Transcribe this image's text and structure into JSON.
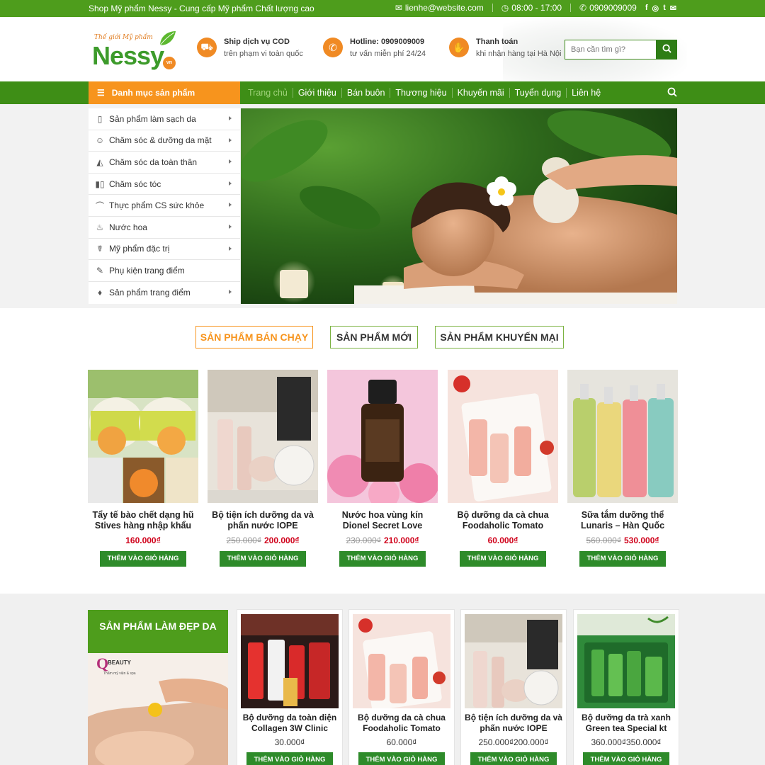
{
  "topbar": {
    "tagline": "Shop Mỹ phẩm Nessy - Cung cấp Mỹ phẩm Chất lượng cao",
    "email": "lienhe@website.com",
    "hours": "08:00 - 17:00",
    "phone": "0909009009"
  },
  "logo": {
    "tagline": "Thế giới Mỹ phẩm",
    "name": "Nessy",
    "badge": "vn"
  },
  "header_info": [
    {
      "title": "Ship dịch vụ COD",
      "sub": "trên phạm vi toàn quốc",
      "icon": "truck-icon"
    },
    {
      "title": "Hotline: 0909009009",
      "sub": "tư vấn miễn phí 24/24",
      "icon": "phone-icon"
    },
    {
      "title": "Thanh toán",
      "sub": "khi nhận hàng tại Hà Nội",
      "icon": "handshake-icon"
    }
  ],
  "search": {
    "placeholder": "Bạn cần tìm gì?"
  },
  "nav": {
    "category_label": "Danh mục sản phẩm",
    "items": [
      "Trang chủ",
      "Giới thiệu",
      "Bán buôn",
      "Thương hiệu",
      "Khuyến mãi",
      "Tuyển dụng",
      "Liên hệ"
    ]
  },
  "sidebar": [
    {
      "label": "Sản phẩm làm sạch da",
      "icon": "tube-icon",
      "has_sub": true
    },
    {
      "label": "Chăm sóc & dưỡng da mặt",
      "icon": "face-care-icon",
      "has_sub": true
    },
    {
      "label": "Chăm sóc da toàn thân",
      "icon": "body-care-icon",
      "has_sub": true
    },
    {
      "label": "Chăm sóc tóc",
      "icon": "hair-care-icon",
      "has_sub": true
    },
    {
      "label": "Thực phẩm CS sức khỏe",
      "icon": "supplement-icon",
      "has_sub": true
    },
    {
      "label": "Nước hoa",
      "icon": "perfume-icon",
      "has_sub": true
    },
    {
      "label": "Mỹ phẩm đặc trị",
      "icon": "treatment-icon",
      "has_sub": true
    },
    {
      "label": "Phụ kiện trang điểm",
      "icon": "accessory-icon",
      "has_sub": false
    },
    {
      "label": "Sản phẩm trang điểm",
      "icon": "makeup-icon",
      "has_sub": true
    }
  ],
  "tabs": [
    "SẢN PHẨM BÁN CHẠY",
    "SẢN PHẨM MỚI",
    "SẢN PHẨM KHUYẾN MẠI"
  ],
  "products": [
    {
      "name": "Tẩy tế bào chết dạng hũ Stives hàng nhập khẩu",
      "old_price": "",
      "price": "160.000₫"
    },
    {
      "name": "Bộ tiện ích dưỡng da và phấn nước IOPE",
      "old_price": "250.000₫",
      "price": "200.000₫"
    },
    {
      "name": "Nước hoa vùng kín Dionel Secret Love",
      "old_price": "230.000₫",
      "price": "210.000₫"
    },
    {
      "name": "Bộ dưỡng da cà chua Foodaholic Tomato",
      "old_price": "",
      "price": "60.000₫"
    },
    {
      "name": "Sữa tắm dưỡng thể Lunaris – Hàn Quốc",
      "old_price": "560.000₫",
      "price": "530.000₫"
    }
  ],
  "add_to_cart": "THÊM VÀO GIỎ HÀNG",
  "section2": {
    "title": "SẢN PHẨM LÀM ĐẸP DA",
    "brand": "Q BEAUTY",
    "brand_sub": "Thẩm mỹ viện & spa",
    "products": [
      {
        "name": "Bộ dưỡng da toàn diện Collagen 3W Clinic",
        "old_price": "",
        "price": "30.000₫"
      },
      {
        "name": "Bộ dưỡng da cà chua Foodaholic Tomato",
        "old_price": "",
        "price": "60.000₫"
      },
      {
        "name": "Bộ tiện ích dưỡng da và phấn nước IOPE",
        "old_price": "250.000₫",
        "price": "200.000₫"
      },
      {
        "name": "Bộ dưỡng da trà xanh Green tea Special kt",
        "old_price": "360.000₫",
        "price": "350.000₫"
      }
    ]
  },
  "colors": {
    "green": "#4e9d1c",
    "dark_green": "#3e8e16",
    "orange": "#f7941d",
    "price_red": "#d0021b",
    "button_green": "#2e8b2a"
  }
}
